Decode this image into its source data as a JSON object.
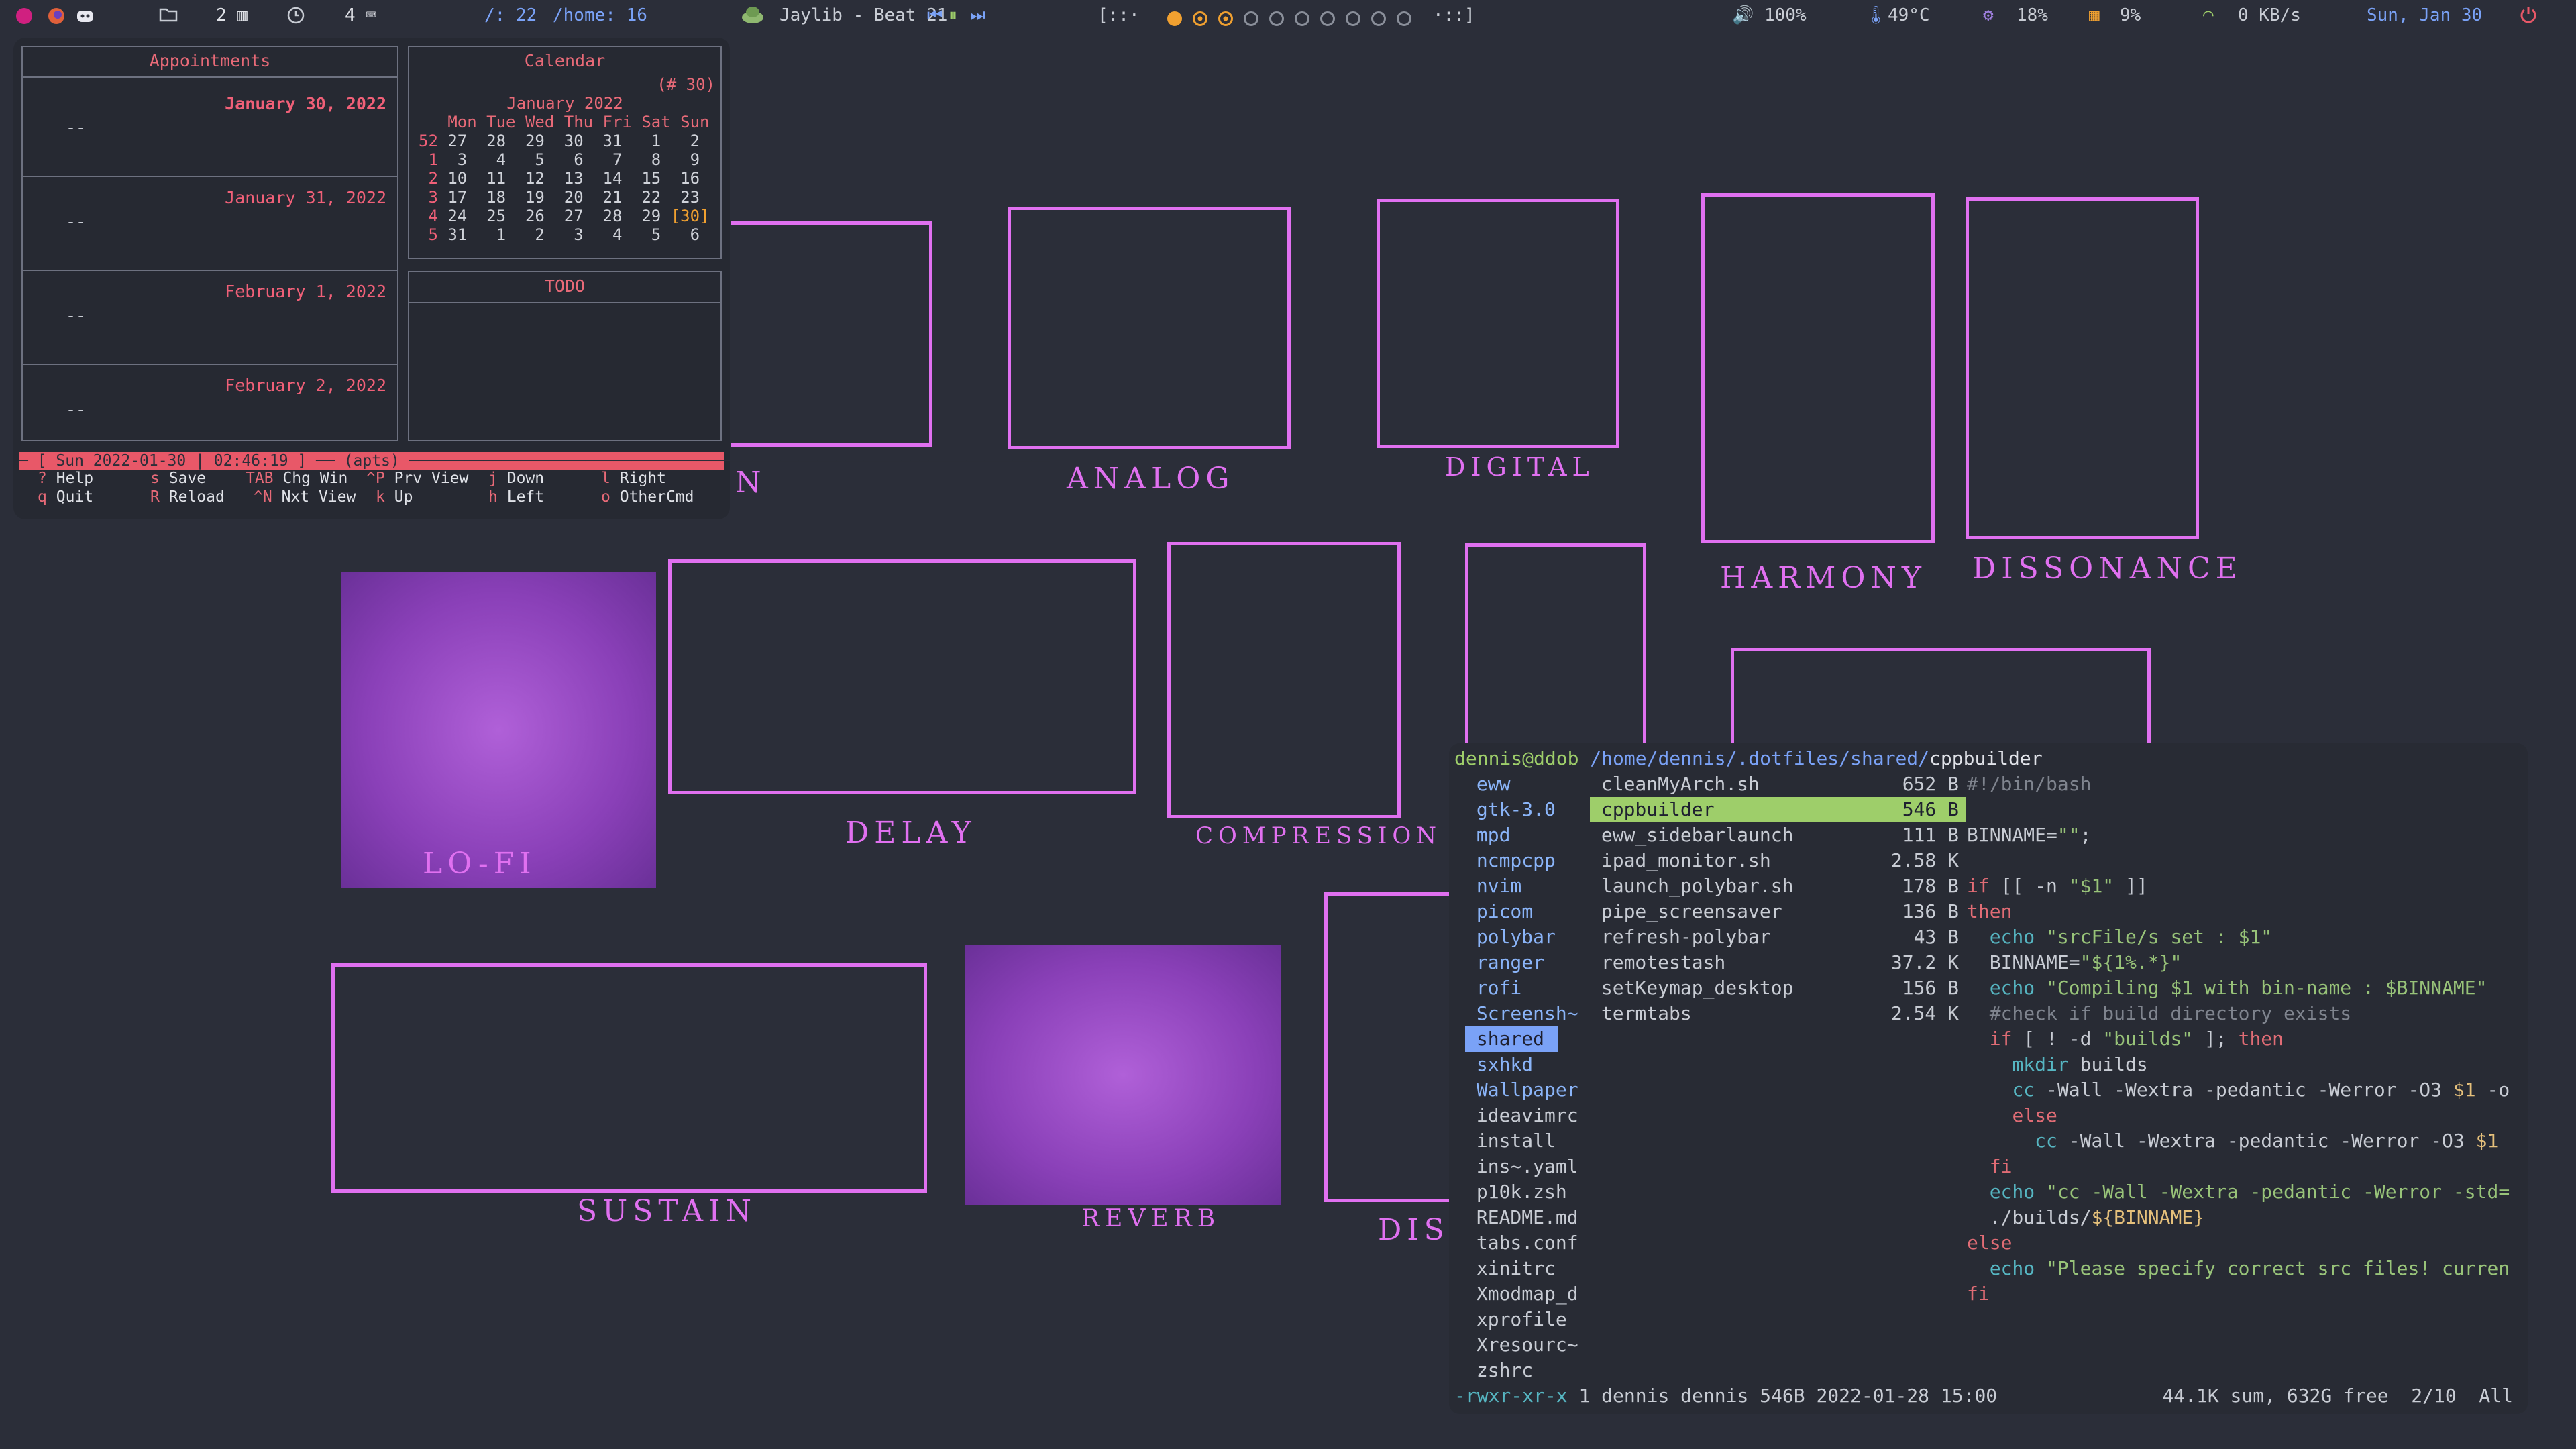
{
  "topbar": {
    "workspaces": [
      "2",
      "4"
    ],
    "ws_icons": [
      "2 ▥",
      "4 ⌨"
    ],
    "root_disk": "/: 22",
    "home_disk": "/home: 16",
    "music": "Jaylib - Beat 21",
    "workspace_dots_label": "[::·",
    "workspace_dots_end": "·::]",
    "volume": "100%",
    "temp": "49°C",
    "cpu": "18%",
    "mem": "9%",
    "net": "0 KB/s",
    "date": "Sun, Jan 30"
  },
  "calendar_panel": {
    "appointments_title": "Appointments",
    "calendar_title": "Calendar",
    "week_count": "(# 30)",
    "todo_title": "TODO",
    "appointments": [
      {
        "date": "January 30, 2022",
        "entry": "--"
      },
      {
        "date": "January 31, 2022",
        "entry": "--"
      },
      {
        "date": "February  1, 2022",
        "entry": "--"
      },
      {
        "date": "February  2, 2022",
        "entry": "--"
      }
    ],
    "month_label": "January 2022",
    "weekday_header": "   Mon Tue Wed Thu Fri Sat Sun",
    "weeks": [
      {
        "wk": "52",
        "days": " 27  28  29  30  31   1   2"
      },
      {
        "wk": " 1",
        "days": "  3   4   5   6   7   8   9"
      },
      {
        "wk": " 2",
        "days": " 10  11  12  13  14  15  16"
      },
      {
        "wk": " 3",
        "days": " 17  18  19  20  21  22  23"
      },
      {
        "wk": " 4",
        "days": " 24  25  26  27  28  29 "
      },
      {
        "wk": " 5",
        "days": " 31   1   2   3   4   5   6"
      }
    ],
    "today_marker": "[30]",
    "status": "─ [ Sun 2022-01-30 | 02:46:19 ] ── (apts) ─────────────────────────────────────────────────────────────────────",
    "help_keys": [
      {
        "k": "?",
        "label": "Help"
      },
      {
        "k": "s",
        "label": "Save"
      },
      {
        "k": "TAB",
        "label": "Chg Win"
      },
      {
        "k": "^P",
        "label": "Prv View"
      },
      {
        "k": "j",
        "label": "Down"
      },
      {
        "k": "l",
        "label": "Right"
      },
      {
        "k": "q",
        "label": "Quit"
      },
      {
        "k": "R",
        "label": "Reload"
      },
      {
        "k": "^N",
        "label": "Nxt View"
      },
      {
        "k": "k",
        "label": "Up"
      },
      {
        "k": "h",
        "label": "Left"
      },
      {
        "k": "o",
        "label": "OtherCmd"
      }
    ]
  },
  "artwork_captions": [
    "N",
    "ANALOG",
    "DIGITAL",
    "HARMONY",
    "DISSONANCE",
    "LO-FI",
    "DELAY",
    "COMPRESSION",
    "SUSTAIN",
    "REVERB",
    "DIST"
  ],
  "terminal": {
    "prompt_user": "dennis@ddob",
    "path_dim": "/home/dennis/.dotfiles/shared/",
    "path_bold": "cppbuilder",
    "dirs": [
      {
        "name": "eww",
        "type": "dir"
      },
      {
        "name": "gtk-3.0",
        "type": "dir"
      },
      {
        "name": "mpd",
        "type": "dir"
      },
      {
        "name": "ncmpcpp",
        "type": "dir"
      },
      {
        "name": "nvim",
        "type": "dir"
      },
      {
        "name": "picom",
        "type": "dir"
      },
      {
        "name": "polybar",
        "type": "dir"
      },
      {
        "name": "ranger",
        "type": "dir"
      },
      {
        "name": "rofi",
        "type": "dir"
      },
      {
        "name": "Screensh~",
        "type": "dir"
      },
      {
        "name": "shared",
        "type": "sel"
      },
      {
        "name": "sxhkd",
        "type": "dir"
      },
      {
        "name": "Wallpaper",
        "type": "dir"
      },
      {
        "name": "ideavimrc",
        "type": "file"
      },
      {
        "name": "install",
        "type": "file"
      },
      {
        "name": "ins~.yaml",
        "type": "file"
      },
      {
        "name": "p10k.zsh",
        "type": "file"
      },
      {
        "name": "README.md",
        "type": "file"
      },
      {
        "name": "tabs.conf",
        "type": "file"
      },
      {
        "name": "xinitrc",
        "type": "file"
      },
      {
        "name": "Xmodmap_d",
        "type": "file"
      },
      {
        "name": "xprofile",
        "type": "file"
      },
      {
        "name": "Xresourc~",
        "type": "file"
      },
      {
        "name": "zshrc",
        "type": "file"
      }
    ],
    "files": [
      {
        "name": "cleanMyArch.sh",
        "size": "652 B"
      },
      {
        "name": "cppbuilder",
        "size": "546 B",
        "selected": true
      },
      {
        "name": "eww_sidebarlaunch",
        "size": "111 B"
      },
      {
        "name": "ipad_monitor.sh",
        "size": "2.58 K"
      },
      {
        "name": "launch_polybar.sh",
        "size": "178 B"
      },
      {
        "name": "pipe_screensaver",
        "size": "136 B"
      },
      {
        "name": "refresh-polybar",
        "size": "43 B"
      },
      {
        "name": "remotestash",
        "size": "37.2 K"
      },
      {
        "name": "setKeymap_desktop",
        "size": "156 B"
      },
      {
        "name": "termtabs",
        "size": "2.54 K"
      }
    ],
    "code_lines": [
      "#!/bin/bash",
      "",
      "BINNAME=\"\";",
      "",
      "if [[ -n \"$1\" ]]",
      "then",
      "  echo \"srcFile/s set : $1\"",
      "  BINNAME=\"${1%.*}\"",
      "  echo \"Compiling $1 with bin-name : $BINNAME\"",
      "  #check if build directory exists",
      "  if [ ! -d \"builds\" ]; then",
      "    mkdir builds",
      "    cc -Wall -Wextra -pedantic -Werror -O3 $1 -o",
      "    else",
      "      cc -Wall -Wextra -pedantic -Werror -O3 $1",
      "  fi",
      "  echo \"cc -Wall -Wextra -pedantic -Werror -std=",
      "  ./builds/${BINNAME}",
      "else",
      "  echo \"Please specify correct src files! curren",
      "fi"
    ],
    "status_perm": "-rwxr-xr-x",
    "status_info": "1 dennis dennis 546B 2022-01-28 15:00",
    "status_right": "44.1K sum, 632G free  2/10  All"
  }
}
